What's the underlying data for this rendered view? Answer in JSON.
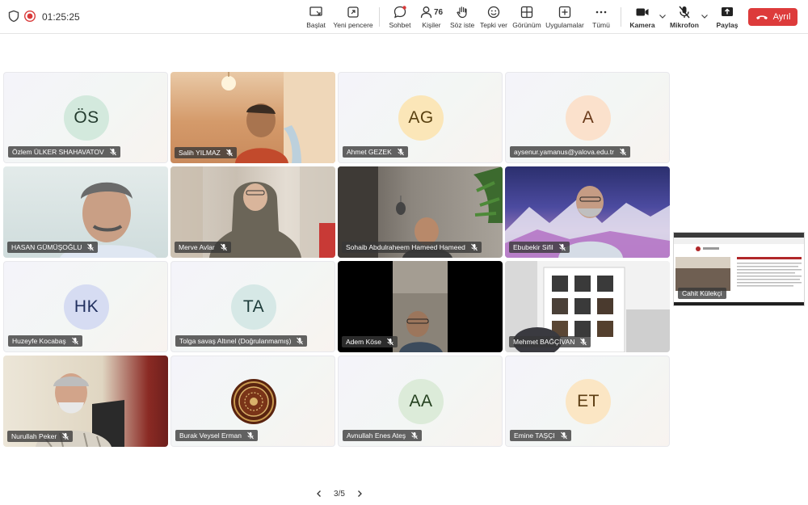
{
  "session": {
    "timer": "01:25:25"
  },
  "toolbar": {
    "start": "Başlat",
    "new_window": "Yeni pencere",
    "chat": "Sohbet",
    "people": "Kişiler",
    "people_count": "76",
    "raise_hand": "Söz iste",
    "react": "Tepki ver",
    "view": "Görünüm",
    "apps": "Uygulamalar",
    "more": "Tümü",
    "camera": "Kamera",
    "mic": "Mikrofon",
    "share": "Paylaş",
    "leave": "Ayrıl"
  },
  "participants": [
    {
      "name": "Özlem ÜLKER SHAHAVATOV",
      "initials": "ÖS",
      "video": false
    },
    {
      "name": "Salih YILMAZ",
      "initials": "",
      "video": true
    },
    {
      "name": "Ahmet GEZEK",
      "initials": "AG",
      "video": false
    },
    {
      "name": "aysenur.yamanus@yalova.edu.tr",
      "initials": "A",
      "video": false
    },
    {
      "name": "HASAN GÜMÜŞOĞLU",
      "initials": "",
      "video": true
    },
    {
      "name": "Merve Avlar",
      "initials": "",
      "video": true
    },
    {
      "name": "Sohaib Abdulraheem Hameed Hameed",
      "initials": "",
      "video": true
    },
    {
      "name": "Ebubekir Sifil",
      "initials": "",
      "video": true
    },
    {
      "name": "Huzeyfe Kocabaş",
      "initials": "HK",
      "video": false
    },
    {
      "name": "Tolga savaş Altınel (Doğrulanmamış)",
      "initials": "TA",
      "video": false
    },
    {
      "name": "Adem Köse",
      "initials": "",
      "video": true
    },
    {
      "name": "Mehmet BAĞÇİVAN",
      "initials": "",
      "video": true
    },
    {
      "name": "Nurullah Peker",
      "initials": "",
      "video": true
    },
    {
      "name": "Burak Veysel Erman",
      "initials": "",
      "video": false
    },
    {
      "name": "Avnullah Enes Ateş",
      "initials": "AA",
      "video": false
    },
    {
      "name": "Emine TAŞÇI",
      "initials": "ET",
      "video": false
    }
  ],
  "screen_share": {
    "name": "Cahit Külekçi"
  },
  "pager": {
    "label": "3/5"
  },
  "colors": {
    "leave": "#dd3b3b",
    "recording": "#d93a3a"
  }
}
